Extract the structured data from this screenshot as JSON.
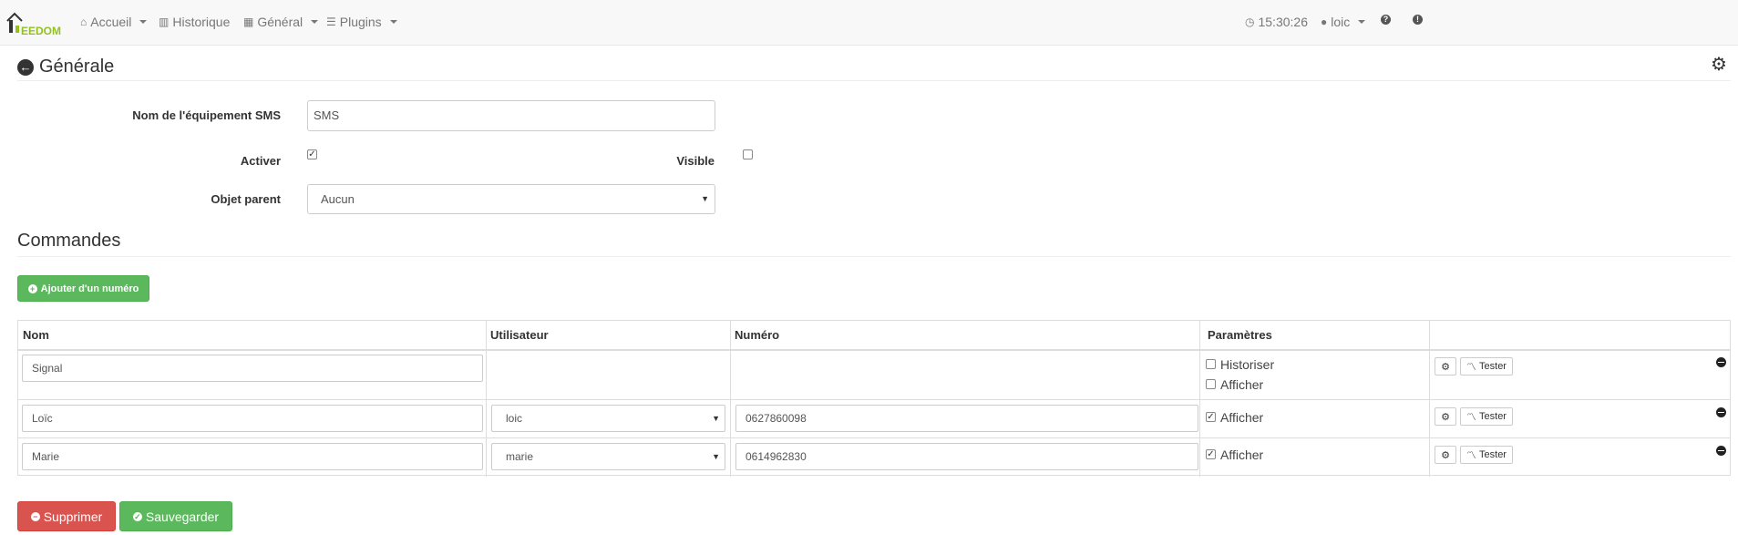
{
  "navbar": {
    "brand": "EEDOM",
    "items": [
      {
        "label": "Accueil",
        "icon": "home-icon",
        "dropdown": true
      },
      {
        "label": "Historique",
        "icon": "bar-chart-icon",
        "dropdown": false
      },
      {
        "label": "Général",
        "icon": "grid-icon",
        "dropdown": true
      },
      {
        "label": "Plugins",
        "icon": "list-icon",
        "dropdown": true
      }
    ],
    "time": "15:30:26",
    "user": "loic"
  },
  "page": {
    "title": "Générale"
  },
  "form": {
    "name_label": "Nom de l'équipement SMS",
    "name_value": "SMS",
    "activate_label": "Activer",
    "activate_checked": true,
    "visible_label": "Visible",
    "visible_checked": false,
    "parent_label": "Objet parent",
    "parent_value": "Aucun"
  },
  "commands": {
    "title": "Commandes",
    "add_button": "Ajouter d'un numéro",
    "columns": [
      "Nom",
      "Utilisateur",
      "Numéro",
      "Paramètres",
      ""
    ],
    "rows": [
      {
        "name": "Signal",
        "user": "",
        "number": "",
        "historiser": false,
        "afficher": false,
        "show_historiser": true
      },
      {
        "name": "Loïc",
        "user": "loic",
        "number": "0627860098",
        "afficher": true,
        "show_historiser": false
      },
      {
        "name": "Marie",
        "user": "marie",
        "number": "0614962830",
        "afficher": true,
        "show_historiser": false
      }
    ],
    "historiser_label": "Historiser",
    "afficher_label": "Afficher",
    "test_label": "Tester"
  },
  "actions": {
    "delete": "Supprimer",
    "save": "Sauvegarder"
  },
  "colors": {
    "success": "#5cb85c",
    "danger": "#d9534f",
    "brand": "#94c11f"
  }
}
